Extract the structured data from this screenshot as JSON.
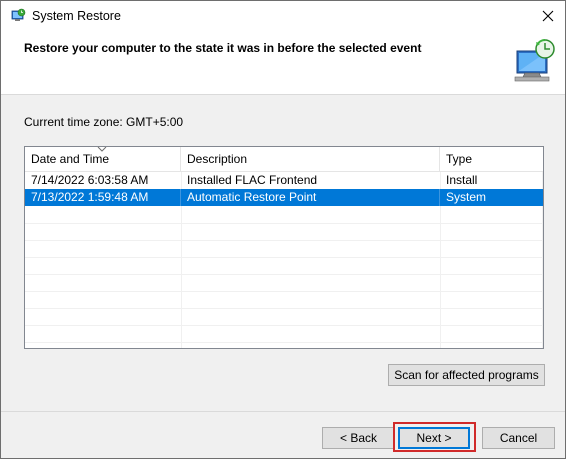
{
  "window": {
    "title": "System Restore",
    "app_icon": "system-restore-icon",
    "close_symbol": "✕"
  },
  "header": {
    "title": "Restore your computer to the state it was in before the selected event",
    "icon": "monitor-restore-icon"
  },
  "timezone": {
    "label": "Current time zone: GMT+5:00"
  },
  "list": {
    "columns": [
      "Date and Time",
      "Description",
      "Type"
    ],
    "sort_column": "Date and Time",
    "rows": [
      {
        "date": "7/14/2022 6:03:58 AM",
        "description": "Installed FLAC Frontend",
        "type": "Install",
        "selected": false
      },
      {
        "date": "7/13/2022 1:59:48 AM",
        "description": "Automatic Restore Point",
        "type": "System",
        "selected": true
      }
    ]
  },
  "buttons": {
    "scan": "Scan for affected programs",
    "back": "< Back",
    "next": "Next >",
    "cancel": "Cancel"
  },
  "colors": {
    "selection": "#0078d7",
    "highlight_box": "#d02a2a"
  }
}
